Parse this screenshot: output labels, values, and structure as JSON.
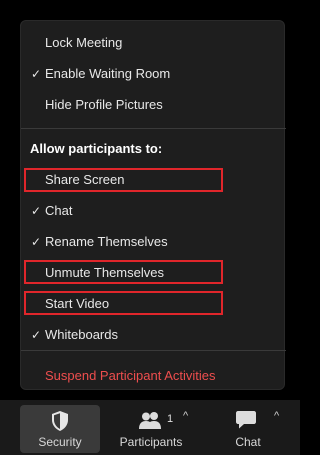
{
  "menu": {
    "items": [
      {
        "label": "Lock Meeting",
        "checked": false
      },
      {
        "label": "Enable Waiting Room",
        "checked": true
      },
      {
        "label": "Hide Profile Pictures",
        "checked": false
      }
    ],
    "section_title": "Allow participants to:",
    "permissions": [
      {
        "label": "Share Screen",
        "checked": false,
        "highlighted": true
      },
      {
        "label": "Chat",
        "checked": true,
        "highlighted": false
      },
      {
        "label": "Rename Themselves",
        "checked": true,
        "highlighted": false
      },
      {
        "label": "Unmute Themselves",
        "checked": false,
        "highlighted": true
      },
      {
        "label": "Start Video",
        "checked": false,
        "highlighted": true
      },
      {
        "label": "Whiteboards",
        "checked": true,
        "highlighted": false
      }
    ],
    "suspend_label": "Suspend Participant Activities",
    "check_glyph": "✓"
  },
  "toolbar": {
    "security_label": "Security",
    "participants_label": "Participants",
    "participants_count": "1",
    "chat_label": "Chat",
    "caret_glyph": "^"
  },
  "colors": {
    "highlight": "#e0262b",
    "danger": "#ee4e4e",
    "menu_bg": "#1e1e1e"
  },
  "icons": {
    "security": "shield-icon",
    "participants": "people-icon",
    "chat": "chat-bubble-icon"
  }
}
